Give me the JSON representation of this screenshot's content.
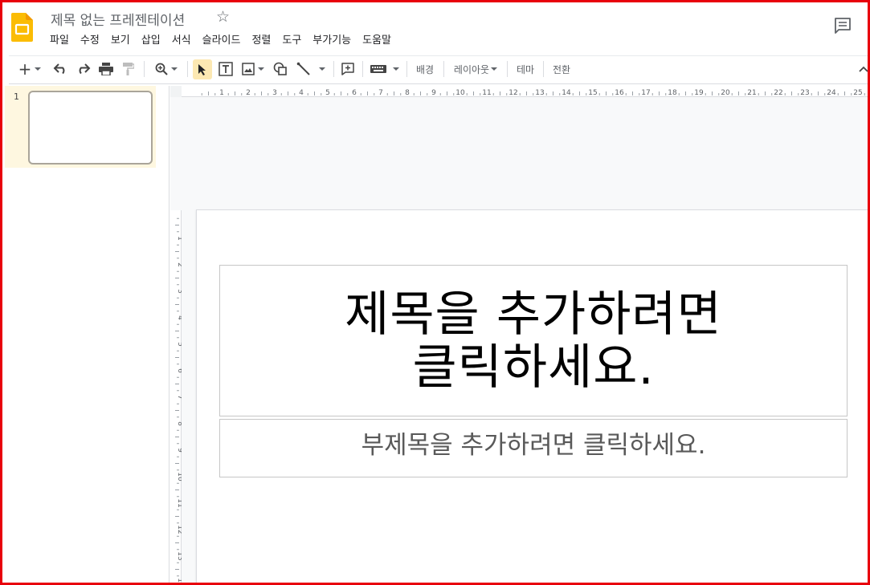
{
  "doc": {
    "title": "제목 없는 프레젠테이션"
  },
  "menu": [
    "파일",
    "수정",
    "보기",
    "삽입",
    "서식",
    "슬라이드",
    "정렬",
    "도구",
    "부가기능",
    "도움말"
  ],
  "toolbar": {
    "background_label": "배경",
    "layout_label": "레이아웃",
    "theme_label": "테마",
    "transition_label": "전환"
  },
  "filmstrip": {
    "slide_number": "1"
  },
  "ruler": {
    "horizontal": [
      "1",
      "2",
      "3",
      "4",
      "5",
      "6",
      "7",
      "8",
      "9",
      "10",
      "11",
      "12",
      "13",
      "14",
      "15",
      "16",
      "17",
      "18",
      "19",
      "20",
      "21",
      "22",
      "23",
      "24",
      "25"
    ],
    "vertical": [
      "1",
      "2",
      "3",
      "4",
      "5",
      "6",
      "7",
      "8",
      "9",
      "10",
      "11",
      "12",
      "13",
      "14"
    ]
  },
  "slide": {
    "title_line1": "제목을 추가하려면",
    "title_line2": "클릭하세요.",
    "subtitle": "부제목을 추가하려면 클릭하세요."
  },
  "colors": {
    "accent_yellow": "#fbbc04",
    "frame_red": "#e8000b",
    "selected_slide_bg": "#fef7e0"
  },
  "icons": [
    "slides-logo-icon",
    "star-icon",
    "comment-icon",
    "new-slide-icon",
    "undo-icon",
    "redo-icon",
    "print-icon",
    "paint-format-icon",
    "zoom-icon",
    "select-icon",
    "textbox-icon",
    "image-icon",
    "shape-icon",
    "line-icon",
    "add-comment-icon",
    "input-tools-icon",
    "collapse-icon"
  ]
}
